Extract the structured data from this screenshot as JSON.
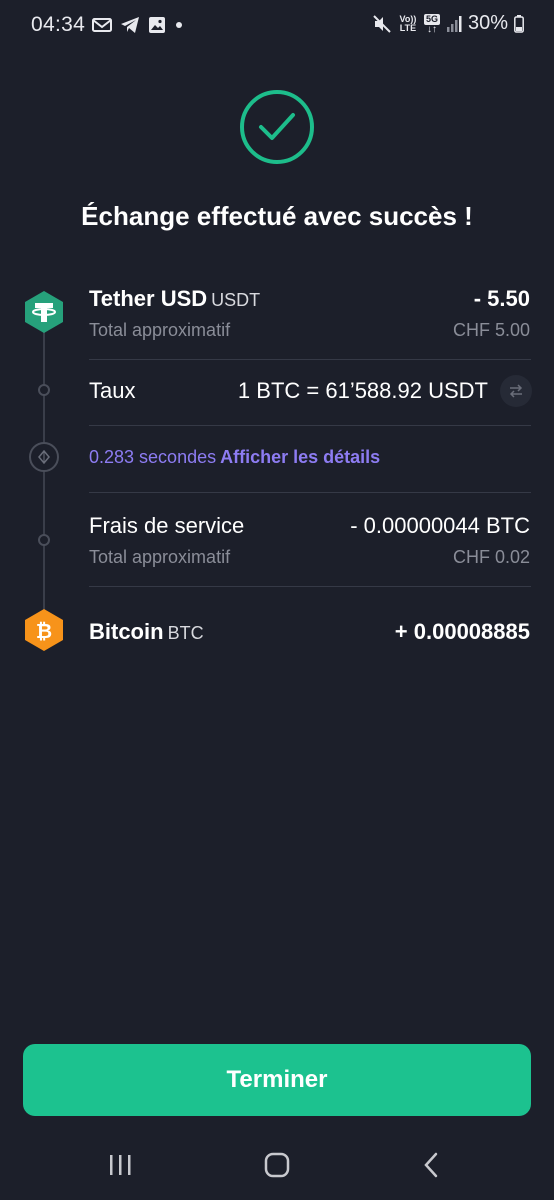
{
  "status_bar": {
    "time": "04:34",
    "battery": "30%",
    "network": "5G",
    "volte": "Vo)) LTE",
    "icons": [
      "gmail-icon",
      "telegram-icon",
      "gallery-icon",
      "dot-icon",
      "mute-icon",
      "volte-icon",
      "5g-icon",
      "signal-icon",
      "battery-icon"
    ]
  },
  "headline": "Échange effectué avec succès !",
  "from": {
    "name": "Tether USD",
    "ticker": "USDT",
    "amount": "- 5.50",
    "approx_label": "Total approximatif",
    "approx_value": "CHF 5.00",
    "icon": "tether-icon",
    "color": "#26a17b"
  },
  "rate": {
    "label": "Taux",
    "value": "1 BTC = 61’588.92 USDT"
  },
  "timing": {
    "duration": "0.283 secondes",
    "details_link": "Afficher les détails"
  },
  "fees": {
    "label": "Frais de service",
    "amount": "- 0.00000044 BTC",
    "approx_label": "Total approximatif",
    "approx_value": "CHF 0.02"
  },
  "to": {
    "name": "Bitcoin",
    "ticker": "BTC",
    "amount": "+ 0.00008885",
    "icon": "bitcoin-icon",
    "color": "#f7931a"
  },
  "finish_button": "Terminer",
  "colors": {
    "background": "#1c1f2a",
    "accent": "#1cc28f",
    "link": "#8d7cf2"
  }
}
